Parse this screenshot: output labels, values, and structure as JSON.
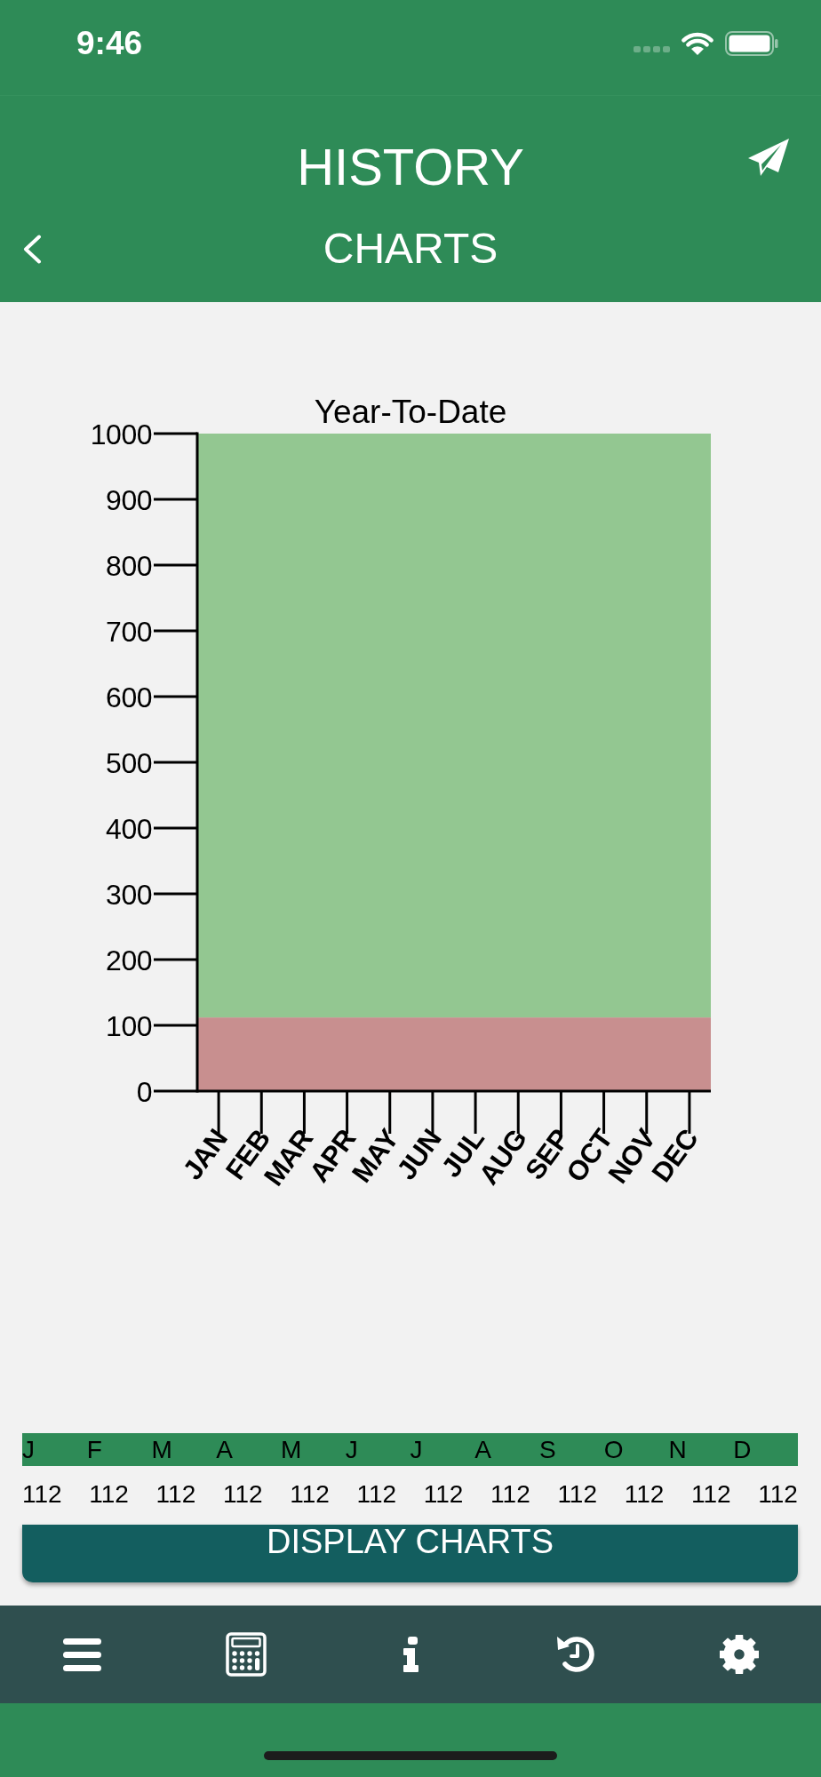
{
  "status_bar": {
    "time": "9:46"
  },
  "header": {
    "title": "HISTORY",
    "subtitle": "CHARTS"
  },
  "chart": {
    "chart_data": {
      "type": "bar",
      "title": "Year-To-Date",
      "categories": [
        "JAN",
        "FEB",
        "MAR",
        "APR",
        "MAY",
        "JUN",
        "JUL",
        "AUG",
        "SEP",
        "OCT",
        "NOV",
        "DEC"
      ],
      "bands": [
        {
          "axis": "y",
          "from": 0,
          "to": 112,
          "color": "#c88f8f"
        },
        {
          "axis": "y",
          "from": 112,
          "to": 1000,
          "color": "#93c791"
        }
      ],
      "ylim": [
        0,
        1000
      ],
      "yticks": [
        0,
        100,
        200,
        300,
        400,
        500,
        600,
        700,
        800,
        900,
        1000
      ]
    }
  },
  "monthly_table": {
    "columns": [
      "J",
      "F",
      "M",
      "A",
      "M",
      "J",
      "J",
      "A",
      "S",
      "O",
      "N",
      "D"
    ],
    "values": [
      "112",
      "112",
      "112",
      "112",
      "112",
      "112",
      "112",
      "112",
      "112",
      "112",
      "112",
      "112"
    ]
  },
  "display_button": {
    "label": "DISPLAY CHARTS"
  }
}
